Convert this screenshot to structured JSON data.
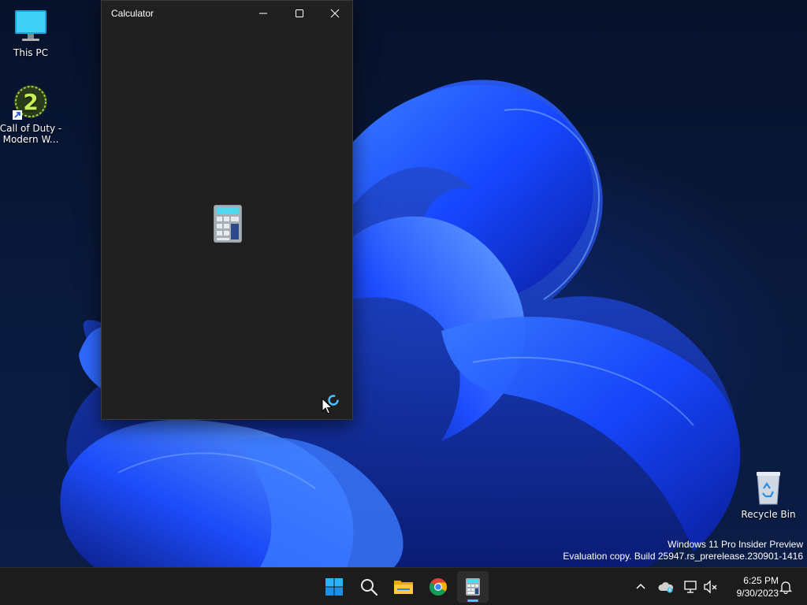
{
  "desktop": {
    "icons": [
      {
        "label": "This PC",
        "icon": "monitor-icon"
      },
      {
        "label": "Call of Duty - Modern W...",
        "icon": "game-shortcut-icon"
      },
      {
        "label": "Recycle Bin",
        "icon": "recycle-bin-icon"
      }
    ],
    "watermark": {
      "line1": "Windows 11 Pro Insider Preview",
      "line2": "Evaluation copy. Build 25947.rs_prerelease.230901-1416"
    }
  },
  "window": {
    "title": "Calculator",
    "state": "loading",
    "controls": [
      "minimize",
      "maximize",
      "close"
    ]
  },
  "taskbar": {
    "apps": [
      {
        "name": "Start",
        "icon": "windows-logo-icon"
      },
      {
        "name": "Search",
        "icon": "search-icon"
      },
      {
        "name": "File Explorer",
        "icon": "folder-icon"
      },
      {
        "name": "Google Chrome",
        "icon": "chrome-icon"
      },
      {
        "name": "Calculator",
        "icon": "calculator-icon",
        "active": true
      }
    ],
    "tray": [
      "chevron-up-icon",
      "onedrive-icon",
      "network-icon",
      "volume-muted-icon",
      "notification-bell-icon"
    ],
    "clock": {
      "time": "6:25 PM",
      "date": "9/30/2023"
    }
  },
  "colors": {
    "window_bg": "#202020",
    "taskbar_bg": "#1c1c1c",
    "accent": "#4cc2ff",
    "wallpaper_blue": "#1646ff"
  }
}
